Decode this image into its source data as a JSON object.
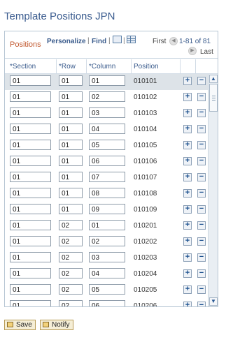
{
  "page": {
    "title": "Template Positions JPN"
  },
  "grid": {
    "title": "Positions",
    "personalize": "Personalize",
    "separator": "|",
    "find": "Find",
    "nav_first": "First",
    "nav_range": "1-81 of 81",
    "nav_last": "Last",
    "columns": {
      "section": "*Section",
      "row": "*Row",
      "column": "*Column",
      "position": "Position"
    },
    "rows": [
      {
        "section": "01",
        "row": "01",
        "column": "01",
        "position": "010101"
      },
      {
        "section": "01",
        "row": "01",
        "column": "02",
        "position": "010102"
      },
      {
        "section": "01",
        "row": "01",
        "column": "03",
        "position": "010103"
      },
      {
        "section": "01",
        "row": "01",
        "column": "04",
        "position": "010104"
      },
      {
        "section": "01",
        "row": "01",
        "column": "05",
        "position": "010105"
      },
      {
        "section": "01",
        "row": "01",
        "column": "06",
        "position": "010106"
      },
      {
        "section": "01",
        "row": "01",
        "column": "07",
        "position": "010107"
      },
      {
        "section": "01",
        "row": "01",
        "column": "08",
        "position": "010108"
      },
      {
        "section": "01",
        "row": "01",
        "column": "09",
        "position": "010109"
      },
      {
        "section": "01",
        "row": "02",
        "column": "01",
        "position": "010201"
      },
      {
        "section": "01",
        "row": "02",
        "column": "02",
        "position": "010202"
      },
      {
        "section": "01",
        "row": "02",
        "column": "03",
        "position": "010203"
      },
      {
        "section": "01",
        "row": "02",
        "column": "04",
        "position": "010204"
      },
      {
        "section": "01",
        "row": "02",
        "column": "05",
        "position": "010205"
      },
      {
        "section": "01",
        "row": "02",
        "column": "06",
        "position": "010206"
      }
    ],
    "add_icon": "plus-icon",
    "delete_icon": "minus-icon"
  },
  "actions": {
    "save": "Save",
    "notify": "Notify"
  }
}
